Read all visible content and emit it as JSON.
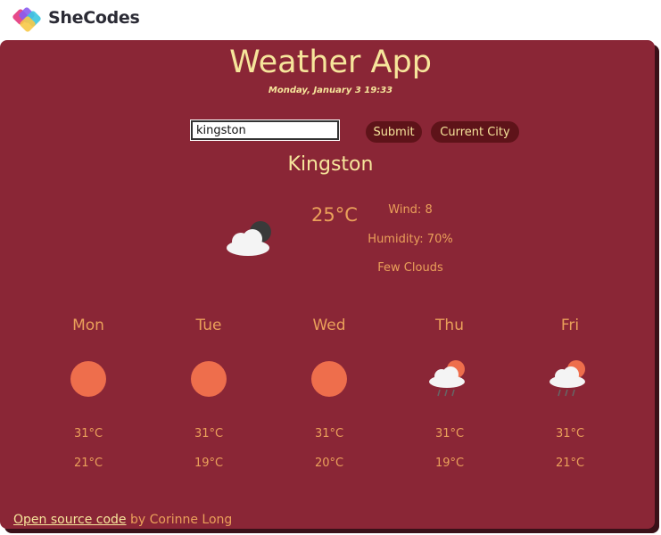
{
  "header": {
    "brand": "SheCodes"
  },
  "app": {
    "title": "Weather App",
    "datetime": "Monday, January 3 19:33"
  },
  "search": {
    "value": "kingston",
    "submit_label": "Submit",
    "current_city_label": "Current City"
  },
  "current": {
    "city": "Kingston",
    "temperature": "25°C",
    "wind": "Wind: 8",
    "humidity": "Humidity: 70%",
    "description": "Few Clouds",
    "icon": "few-clouds-night-icon"
  },
  "forecast": [
    {
      "day": "Mon",
      "max": "31°C",
      "min": "21°C",
      "icon": "sun-icon"
    },
    {
      "day": "Tue",
      "max": "31°C",
      "min": "19°C",
      "icon": "sun-icon"
    },
    {
      "day": "Wed",
      "max": "31°C",
      "min": "20°C",
      "icon": "sun-icon"
    },
    {
      "day": "Thu",
      "max": "31°C",
      "min": "19°C",
      "icon": "rain-cloud-sun-icon"
    },
    {
      "day": "Fri",
      "max": "31°C",
      "min": "21°C",
      "icon": "rain-cloud-sun-icon"
    }
  ],
  "footer": {
    "link_text": "Open source code",
    "suffix": " by Corinne Long"
  },
  "colors": {
    "card_background": "#8a2636",
    "title_yellow": "#f6e59b",
    "text_orange": "#eaa05a",
    "button_background": "#5e1319",
    "sun": "#ee6e4c"
  }
}
